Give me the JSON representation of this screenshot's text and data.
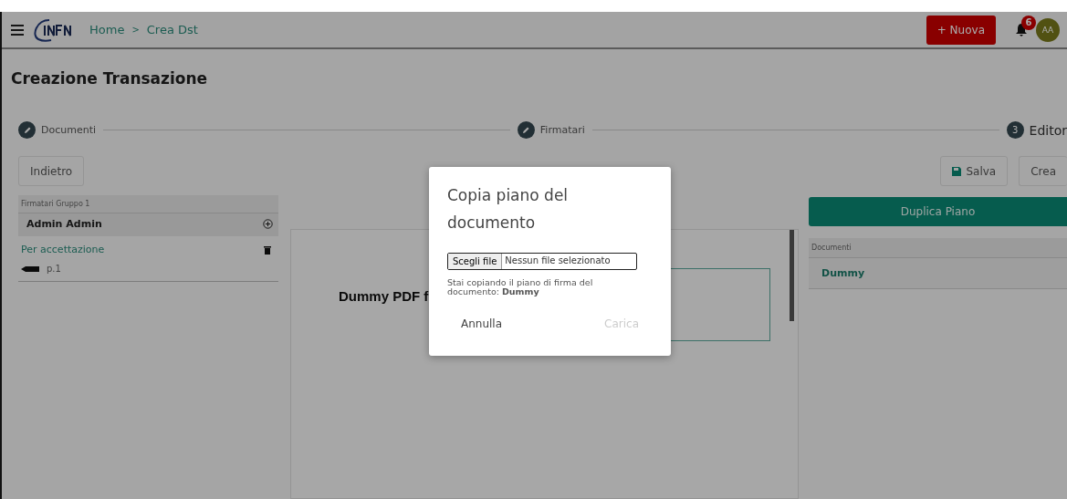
{
  "header": {
    "breadcrumb": [
      {
        "label": "Home"
      },
      {
        "label": "Crea Dst"
      }
    ],
    "separator": ">",
    "new_button": "+ Nuova",
    "notifications": "6",
    "avatar": "AA"
  },
  "page_title": "Creazione Transazione",
  "steps": [
    {
      "label": "Documenti",
      "kind": "done"
    },
    {
      "label": "Firmatari",
      "kind": "done"
    },
    {
      "label": "Editor",
      "kind": "number",
      "number": "3"
    }
  ],
  "back_button": "Indietro",
  "save_button": "Salva",
  "create_button": "Crea",
  "signers": {
    "group": "Firmatari Gruppo 1",
    "name": "Admin Admin",
    "fields": [
      {
        "type": "Per accettazione",
        "page": "p.1"
      }
    ]
  },
  "document": {
    "text": "Dummy PDF f"
  },
  "duplicate_button": "Duplica Piano",
  "documents": {
    "heading": "Documenti",
    "items": [
      {
        "name": "Dummy"
      }
    ]
  },
  "dialog": {
    "title": "Copia piano del documento",
    "file_button": "Scegli file",
    "file_status": "Nessun file selezionato",
    "message": "Stai copiando il piano di firma del documento: **Dummy**",
    "cancel": "Annulla",
    "submit": "Carica",
    "submit_disabled": true
  }
}
